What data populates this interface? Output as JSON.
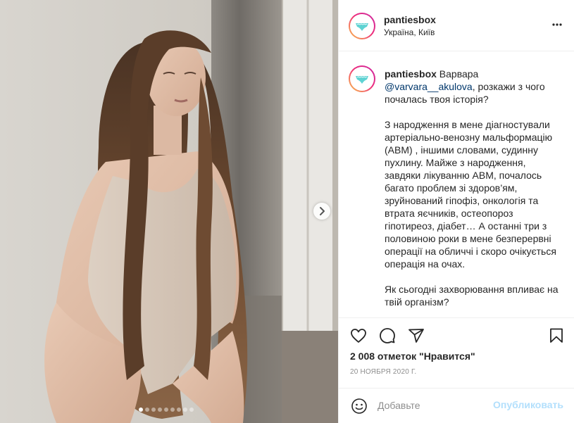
{
  "post": {
    "username": "pantiesbox",
    "location": "Україна, Київ",
    "more_icon": "more-horizontal-icon",
    "caption": {
      "author": "pantiesbox",
      "greeting": "Варвара",
      "mention": "@varvara__akulova",
      "question": ", розкажи з чого почалась твоя історія?",
      "answer": "З народження в мене діагностували артеріально-венозну мальформацію (АВМ) , іншими словами, судинну пухлину. Майже з народження, завдяки лікуванню АВМ, почалось багато проблем зі здоров’ям, зруйнований гіпофіз, онкологія та втрата яєчників, остеопороз гіпотиреоз, діабет… А останні три з половиною роки в мене безперервні операції на обличчі і скоро очікується операція на очах.",
      "question2": "Як сьогодні захворювання впливає на твій організм?"
    },
    "likes_text": "2 008 отметок \"Нравится\"",
    "date": "20 НОЯБРЯ 2020 Г.",
    "comment": {
      "placeholder": "Добавьте",
      "publish_label": "Опубликовать"
    },
    "carousel": {
      "slide_count": 9,
      "active_index": 0
    },
    "icons": [
      "heart-icon",
      "comment-icon",
      "share-icon",
      "bookmark-icon",
      "emoji-icon",
      "chevron-right-icon"
    ],
    "colors": {
      "mention": "#00376b",
      "publish_disabled": "#b2dffc",
      "secondary_text": "#8e8e8e",
      "avatar_gradient_start": "#f9c846",
      "avatar_gradient_end": "#c72aa6",
      "logo_teal": "#5fd3d3"
    }
  }
}
